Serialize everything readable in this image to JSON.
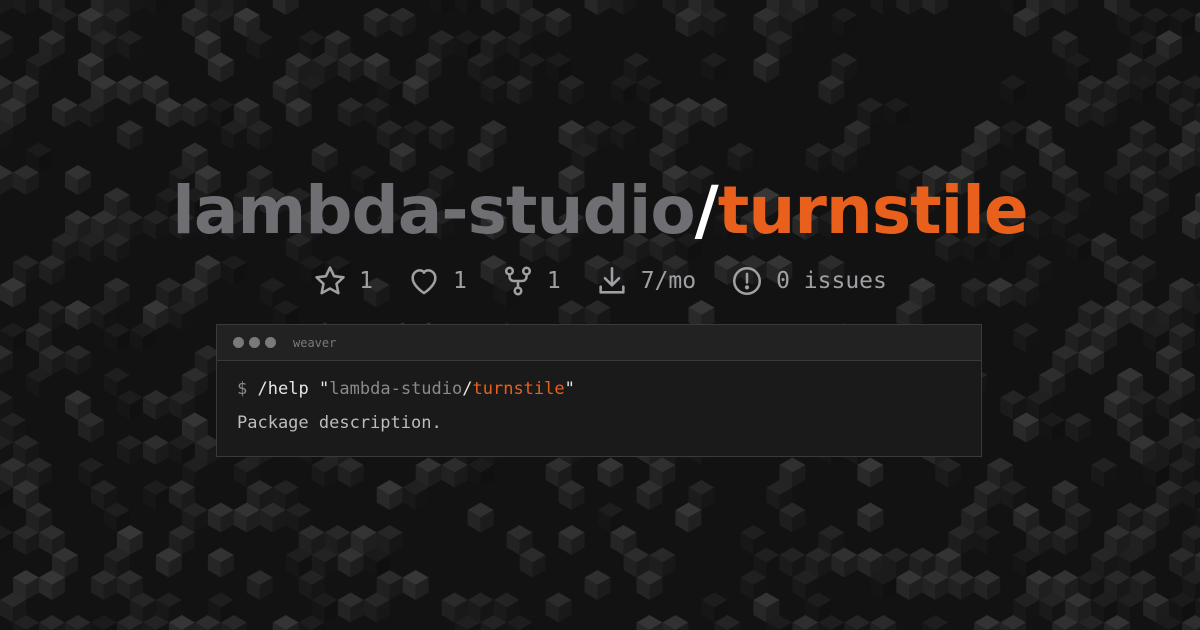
{
  "title": {
    "owner": "lambda-studio",
    "slash": "/",
    "repo": "turnstile"
  },
  "stats": [
    {
      "icon": "star-icon",
      "value": "1"
    },
    {
      "icon": "heart-icon",
      "value": "1"
    },
    {
      "icon": "fork-icon",
      "value": "1"
    },
    {
      "icon": "download-icon",
      "value": "7/mo"
    },
    {
      "icon": "issue-icon",
      "value": "0 issues"
    }
  ],
  "terminal": {
    "name": "weaver",
    "prompt": "$",
    "command": "/help",
    "quote": "\"",
    "description": "Package description."
  },
  "colors": {
    "accent": "#e8601c",
    "owner": "#6e6e73",
    "background": "#121212"
  }
}
